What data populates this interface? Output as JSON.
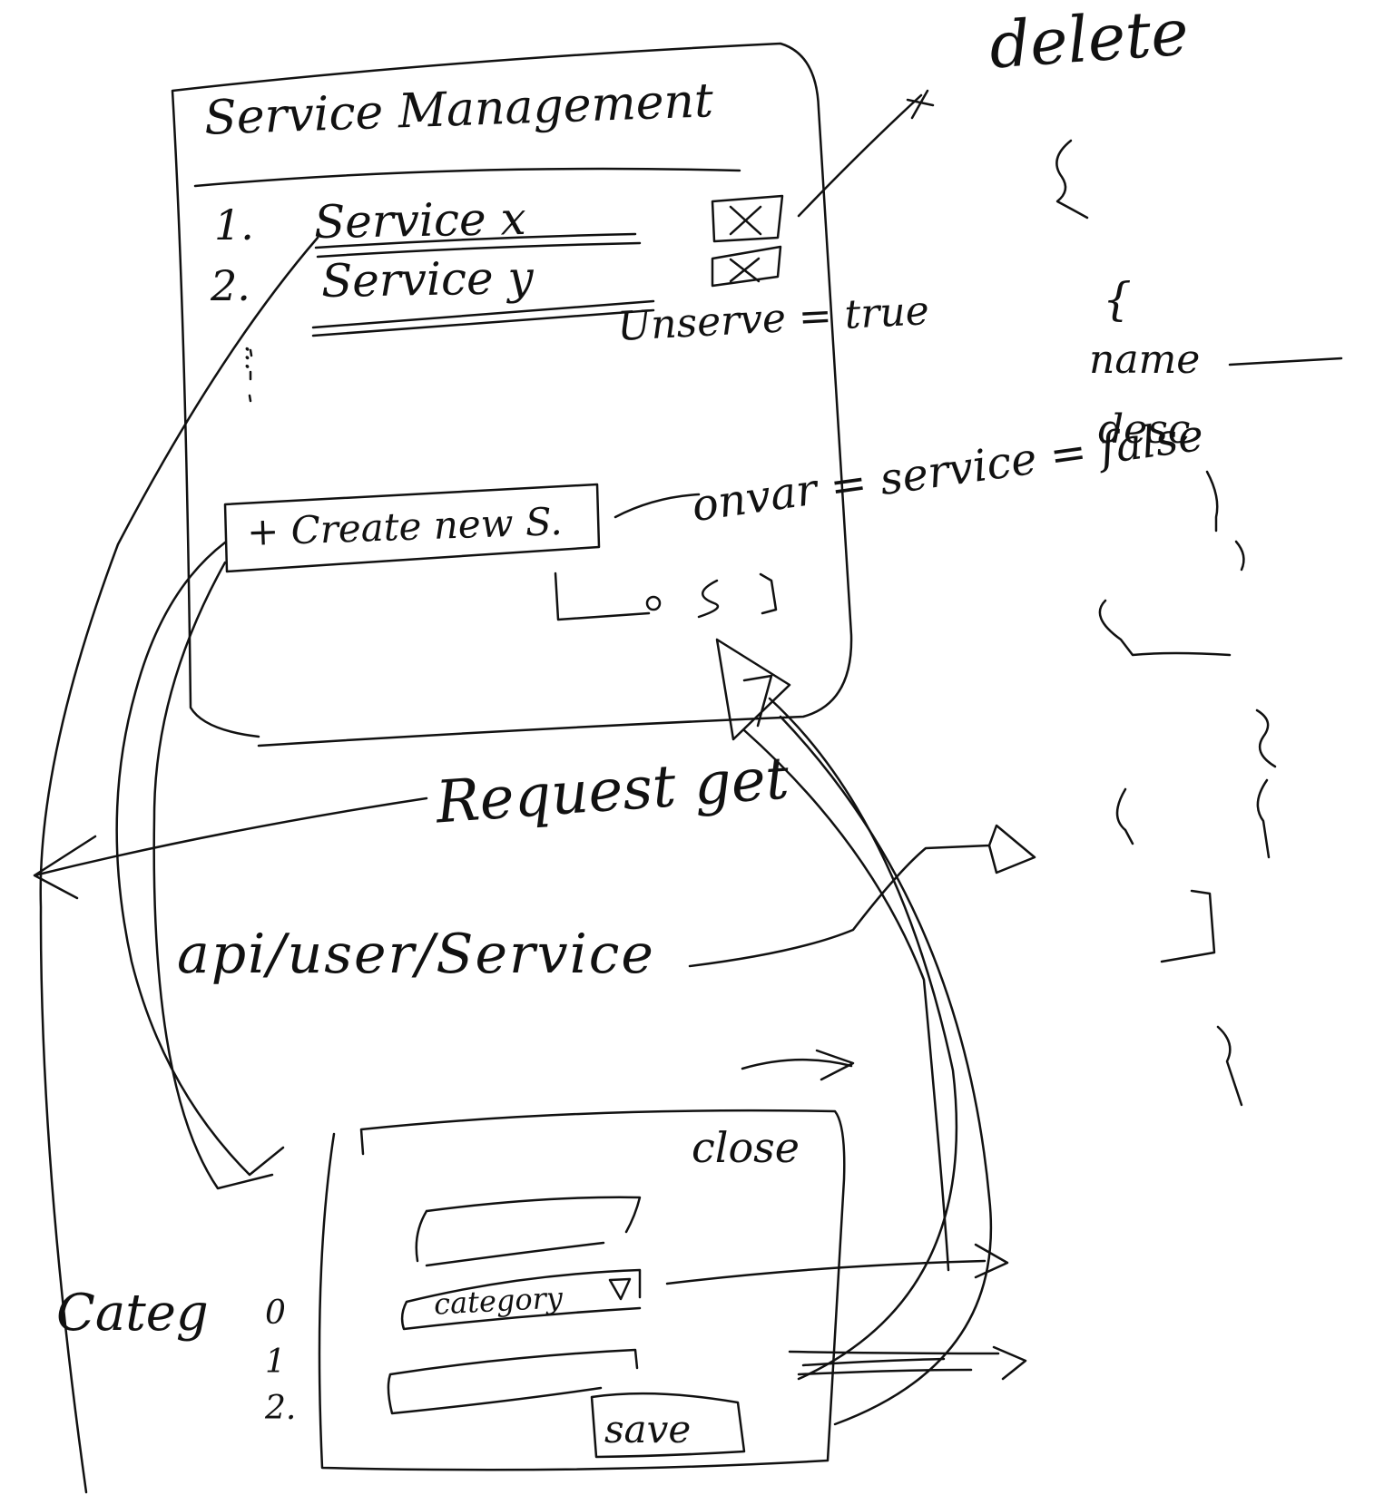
{
  "service_management": {
    "title": "Service Management",
    "items": [
      {
        "number": "1.",
        "label": "Service x"
      },
      {
        "number": "2.",
        "label": "Service y"
      }
    ],
    "more": "...",
    "create_button": "+ Create new S."
  },
  "annotations": {
    "delete": "delete",
    "unserve": "Unserve = true",
    "onvar": "onvar = service = false",
    "request": "Request get",
    "endpoint": "api/user/Service",
    "json_open": "{",
    "name_field": "name",
    "desc_field": "desc"
  },
  "create_modal": {
    "close": "close",
    "category_select": "category",
    "save": "save"
  },
  "category_note": {
    "label": "Categ",
    "options": [
      "0",
      "1",
      "2."
    ]
  }
}
